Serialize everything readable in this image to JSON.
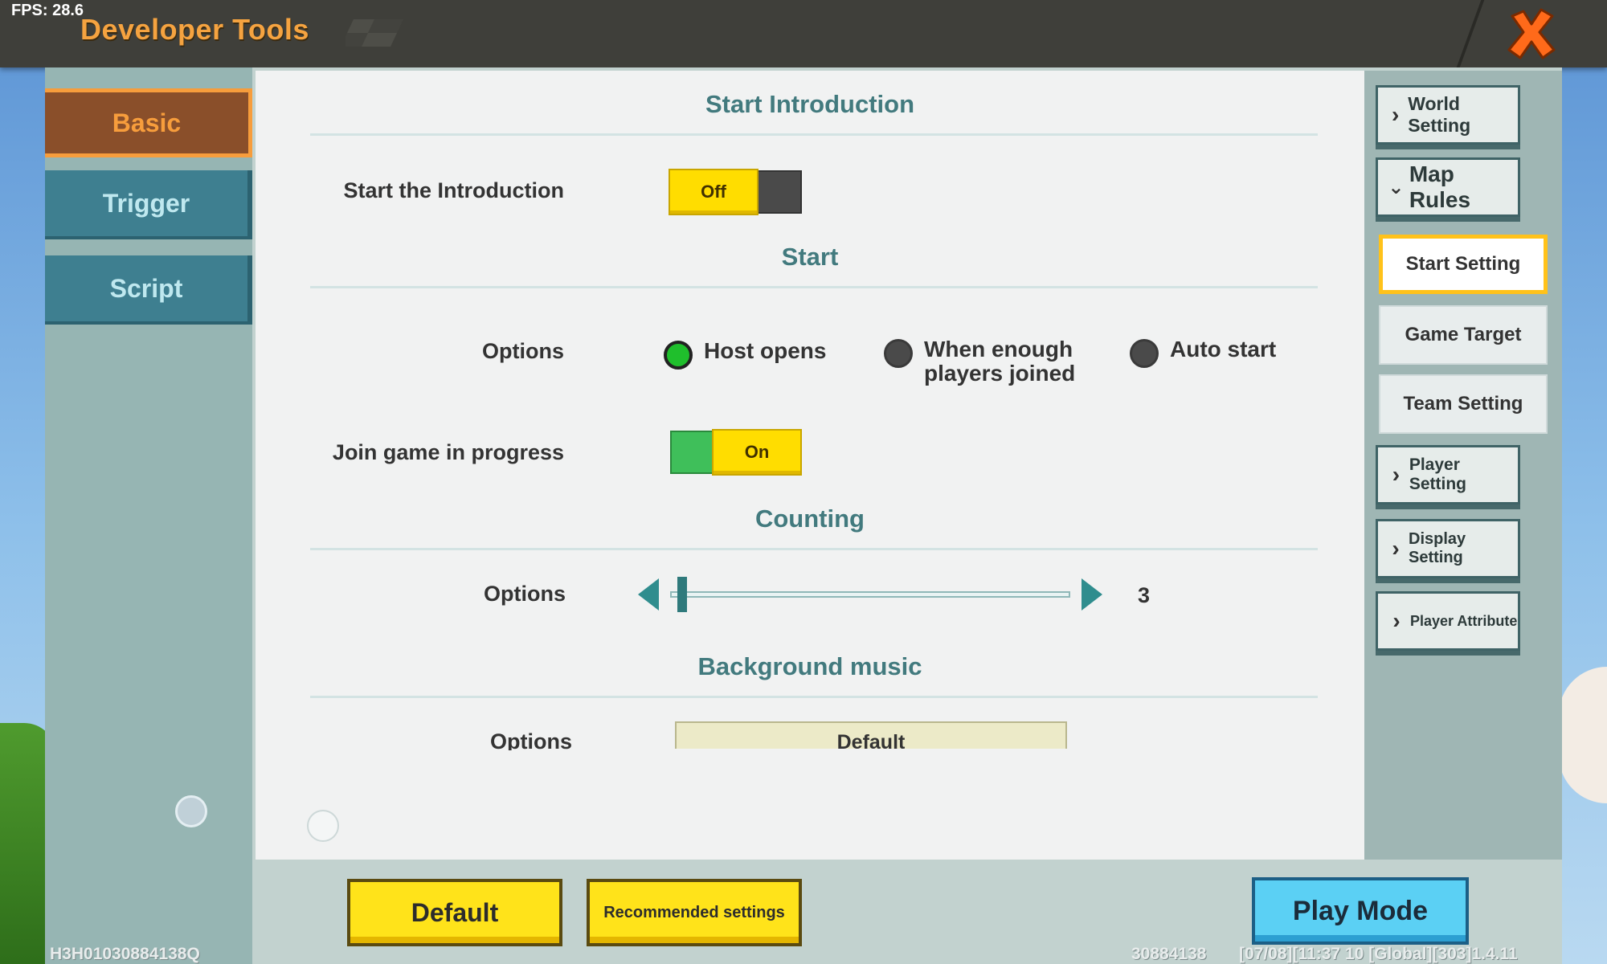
{
  "header": {
    "fps": "FPS: 28.6",
    "title": "Developer Tools"
  },
  "left_tabs": [
    {
      "label": "Basic",
      "active": true
    },
    {
      "label": "Trigger",
      "active": false
    },
    {
      "label": "Script",
      "active": false
    }
  ],
  "sections": {
    "intro": {
      "title": "Start Introduction",
      "row_label": "Start the Introduction",
      "toggle": "Off"
    },
    "start": {
      "title": "Start",
      "options_label": "Options",
      "radios": [
        {
          "label": "Host opens",
          "selected": true
        },
        {
          "label": "When enough players joined",
          "selected": false
        },
        {
          "label": "Auto start",
          "selected": false
        }
      ],
      "join_label": "Join game in progress",
      "join_toggle": "On"
    },
    "counting": {
      "title": "Counting",
      "options_label": "Options",
      "value": "3"
    },
    "music": {
      "title": "Background music",
      "options_label": "Options",
      "selected": "Default"
    }
  },
  "right_nav": {
    "world_setting": "World Setting",
    "map_rules": "Map Rules",
    "sub_items": [
      "Start Setting",
      "Game Target",
      "Team Setting"
    ],
    "player_setting": "Player Setting",
    "display_setting": "Display Setting",
    "player_attribute": "Player Attribute"
  },
  "bottom": {
    "default_button": "Default",
    "recommended_button": "Recommended settings",
    "play_mode_button": "Play Mode"
  },
  "footer": {
    "left_id": "H3H01030884138Q",
    "right_id": "30884138",
    "build_info": "[07/08][11:37 10  [Global][303]1.4.11"
  },
  "colors": {
    "accent_orange": "#f79d3c",
    "toggle_yellow": "#ffdd00",
    "radio_selected": "#1fbf2c",
    "section_title": "#427a7e",
    "play_blue": "#5bd0f4"
  }
}
